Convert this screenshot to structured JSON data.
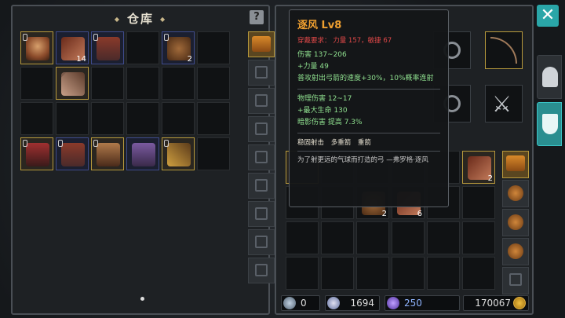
{
  "storage": {
    "title": "仓库",
    "help": "?",
    "slots": [
      {
        "type": "gold",
        "item": "face",
        "lock": true,
        "qty": ""
      },
      {
        "type": "blue",
        "item": "feather",
        "lock": false,
        "qty": "14"
      },
      {
        "type": "blue",
        "item": "boots",
        "lock": true,
        "qty": ""
      },
      {
        "type": "empty"
      },
      {
        "type": "blue",
        "item": "pouch",
        "lock": true,
        "qty": "2"
      },
      {
        "type": "empty"
      },
      {
        "type": "empty"
      },
      {
        "type": "gold",
        "item": "bow",
        "lock": false,
        "qty": ""
      },
      {
        "type": "empty"
      },
      {
        "type": "empty"
      },
      {
        "type": "empty"
      },
      {
        "type": "empty"
      },
      {
        "type": "empty"
      },
      {
        "type": "empty"
      },
      {
        "type": "empty"
      },
      {
        "type": "empty"
      },
      {
        "type": "empty"
      },
      {
        "type": "empty"
      },
      {
        "type": "gold",
        "item": "armor",
        "lock": true,
        "qty": ""
      },
      {
        "type": "blue",
        "item": "boots",
        "lock": true,
        "qty": ""
      },
      {
        "type": "gold",
        "item": "gloves",
        "lock": true,
        "qty": ""
      },
      {
        "type": "blue",
        "item": "hat",
        "lock": false,
        "qty": ""
      },
      {
        "type": "gold",
        "item": "staff",
        "lock": true,
        "qty": ""
      },
      {
        "type": "empty"
      }
    ]
  },
  "tooltip": {
    "name": "逐风 Lv8",
    "requirement": "穿戴要求：  力量 157，敏捷 67",
    "stats_block1": [
      "伤害  137~206",
      "+力量 49",
      "普攻射出弓箭的速度+30%，10%概率连射"
    ],
    "stats_block2": [
      "物理伤害 12~17",
      "+最大生命 130",
      "暗影伤害 提高 7.3%"
    ],
    "skills": "稳固射击  多重箭  重箭",
    "description": "为了射更远的气球而打造的弓      —弗罗格·逐风"
  },
  "inventory": {
    "grid_qty": {
      "5": "2",
      "8": "2",
      "9": "6"
    }
  },
  "currency": {
    "scrolls": "0",
    "souls": "1694",
    "gems": "250",
    "gold": "170067"
  },
  "close_label": "✕"
}
